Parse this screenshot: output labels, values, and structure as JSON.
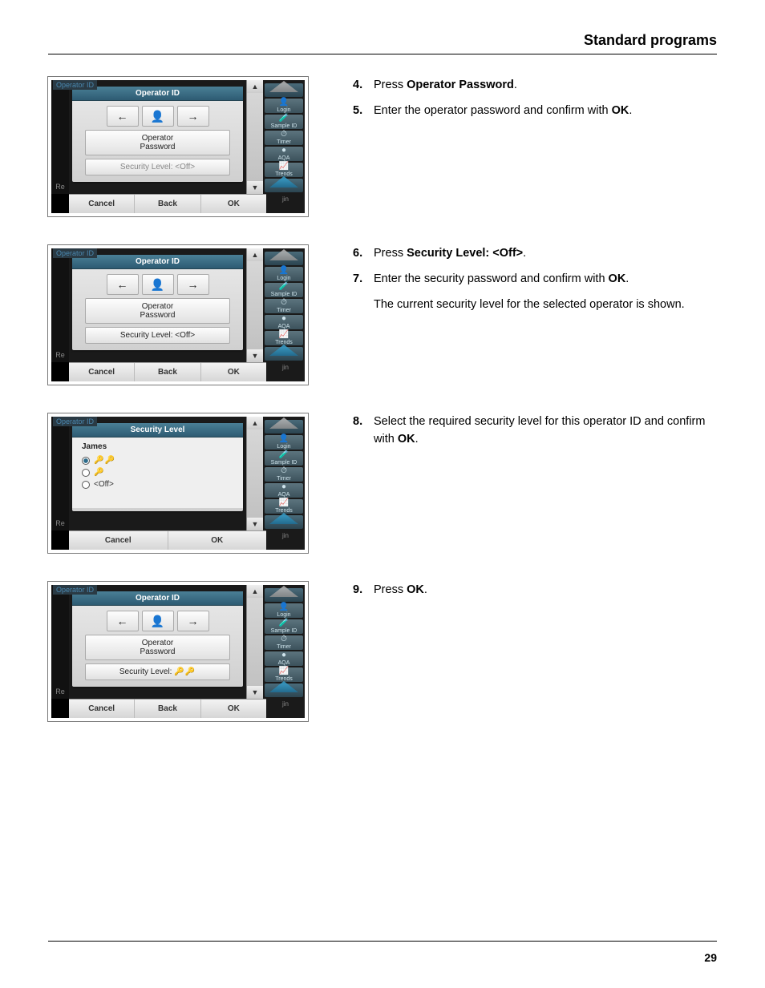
{
  "header": {
    "title": "Standard programs"
  },
  "page_number": "29",
  "devices": {
    "a": {
      "tab": "Operator ID",
      "panel_title": "Operator ID",
      "arrow_left": "←",
      "arrow_user": "👤",
      "arrow_right": "→",
      "op_password_line1": "Operator",
      "op_password_line2": "Password",
      "security_level_text": "Security Level:  <Off>",
      "btn_cancel": "Cancel",
      "btn_back": "Back",
      "btn_ok": "OK",
      "left_edge": "Re",
      "side_right_bottom": "jin"
    },
    "b": {
      "tab": "Operator ID",
      "panel_title": "Operator ID",
      "arrow_left": "←",
      "arrow_user": "👤",
      "arrow_right": "→",
      "op_password_line1": "Operator",
      "op_password_line2": "Password",
      "security_level_text": "Security Level:  <Off>",
      "btn_cancel": "Cancel",
      "btn_back": "Back",
      "btn_ok": "OK",
      "left_edge": "Re",
      "side_right_bottom": "jin"
    },
    "c": {
      "tab": "Operator ID",
      "panel_title": "Security Level",
      "list_name": "James",
      "opt1_keys": "🔑🔑",
      "opt2_keys": "🔑",
      "opt3_text": "<Off>",
      "btn_cancel": "Cancel",
      "btn_ok": "OK",
      "left_edge": "Re",
      "side_right_bottom": "jin"
    },
    "d": {
      "tab": "Operator ID",
      "panel_title": "Operator ID",
      "arrow_left": "←",
      "arrow_user": "👤",
      "arrow_right": "→",
      "op_password_line1": "Operator",
      "op_password_line2": "Password",
      "security_level_label": "Security Level:",
      "security_level_icons": "🔑🔑",
      "btn_cancel": "Cancel",
      "btn_back": "Back",
      "btn_ok": "OK",
      "left_edge": "Re",
      "side_right_bottom": "jin"
    }
  },
  "side_labels": {
    "login": "Login",
    "sample_id": "Sample ID",
    "timer": "Timer",
    "aqa": "AQA",
    "trends": "Trends"
  },
  "steps": {
    "s4": {
      "num": "4.",
      "pre": "Press ",
      "bold": "Operator Password",
      "post": "."
    },
    "s5": {
      "num": "5.",
      "pre": "Enter the operator password and confirm with ",
      "bold": "OK",
      "post": "."
    },
    "s6": {
      "num": "6.",
      "pre": "Press ",
      "bold": "Security Level: <Off>",
      "post": "."
    },
    "s7": {
      "num": "7.",
      "pre": "Enter the security password and confirm with ",
      "bold": "OK",
      "post": ".",
      "sub": "The current security level for the selected operator is shown."
    },
    "s8": {
      "num": "8.",
      "pre": "Select the required security level for this operator ID and confirm with ",
      "bold": "OK",
      "post": "."
    },
    "s9": {
      "num": "9.",
      "pre": "Press ",
      "bold": "OK",
      "post": "."
    }
  }
}
